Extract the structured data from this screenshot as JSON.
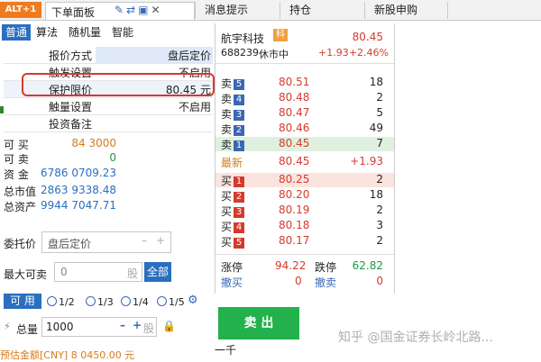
{
  "tabs": {
    "alt": "ALT+1",
    "main": "下单面板",
    "others": [
      "消息提示",
      "持仓",
      "新股申购"
    ]
  },
  "subtabs": [
    "普通",
    "算法",
    "随机量",
    "智能"
  ],
  "grid": {
    "head": {
      "label": "报价方式",
      "value": "盘后定价"
    },
    "r1": {
      "label": "触发设置",
      "value": "不启用"
    },
    "r2": {
      "label": "保护限价",
      "value": "80.45 元"
    },
    "r3": {
      "label": "触量设置",
      "value": "不启用"
    },
    "r4": {
      "label": "投资备注",
      "value": ""
    }
  },
  "account": [
    {
      "k": "可 买",
      "v": "84 3000"
    },
    {
      "k": "可 卖",
      "v": "0"
    },
    {
      "k": "资 金",
      "v": "6786 0709.23"
    },
    {
      "k": "总市值",
      "v": "2863 9338.48"
    },
    {
      "k": "总资产",
      "v": "9944 7047.71"
    }
  ],
  "order": {
    "entrust_label": "委托价",
    "entrust_value": "盘后定价",
    "maxsell_label": "最大可卖",
    "maxsell_value": "0",
    "maxsell_unit": "股",
    "all_btn": "全部",
    "avail_btn": "可 用",
    "ratios": [
      "1/2",
      "1/3",
      "1/4",
      "1/5"
    ],
    "qty_label": "总量",
    "qty_value": "1000",
    "qty_unit": "股",
    "sell_btn": "卖 出",
    "note": "一千",
    "amount": "预估金额[CNY] 8 0450.00 元"
  },
  "quote": {
    "name": "航宇科技",
    "tag": "科",
    "price": "80.45",
    "code": "688239",
    "status": "休市中",
    "chg": "+1.93",
    "pct": "+2.46%",
    "sells": [
      {
        "label": "卖",
        "n": "5",
        "px": "80.51",
        "vol": "18"
      },
      {
        "label": "卖",
        "n": "4",
        "px": "80.48",
        "vol": "2"
      },
      {
        "label": "卖",
        "n": "3",
        "px": "80.47",
        "vol": "5"
      },
      {
        "label": "卖",
        "n": "2",
        "px": "80.46",
        "vol": "49"
      },
      {
        "label": "卖",
        "n": "1",
        "px": "80.45",
        "vol": "7"
      }
    ],
    "last": {
      "label": "最新",
      "px": "80.45",
      "chg": "+1.93"
    },
    "buys": [
      {
        "label": "买",
        "n": "1",
        "px": "80.25",
        "vol": "2"
      },
      {
        "label": "买",
        "n": "2",
        "px": "80.20",
        "vol": "18"
      },
      {
        "label": "买",
        "n": "3",
        "px": "80.19",
        "vol": "2"
      },
      {
        "label": "买",
        "n": "4",
        "px": "80.18",
        "vol": "3"
      },
      {
        "label": "买",
        "n": "5",
        "px": "80.17",
        "vol": "2"
      }
    ],
    "limit_up_label": "涨停",
    "limit_up": "94.22",
    "limit_down_label": "跌停",
    "limit_down": "62.82",
    "cancel_buy_label": "撤买",
    "cancel_buy": "0",
    "cancel_sell_label": "撤卖",
    "cancel_sell": "0"
  },
  "watermark": "知乎 @国金证券长岭北路...",
  "colors": {
    "red": "#d63a2d",
    "green": "#1a9b3c",
    "blue": "#2a6fc0",
    "orange": "#d67b1a"
  }
}
